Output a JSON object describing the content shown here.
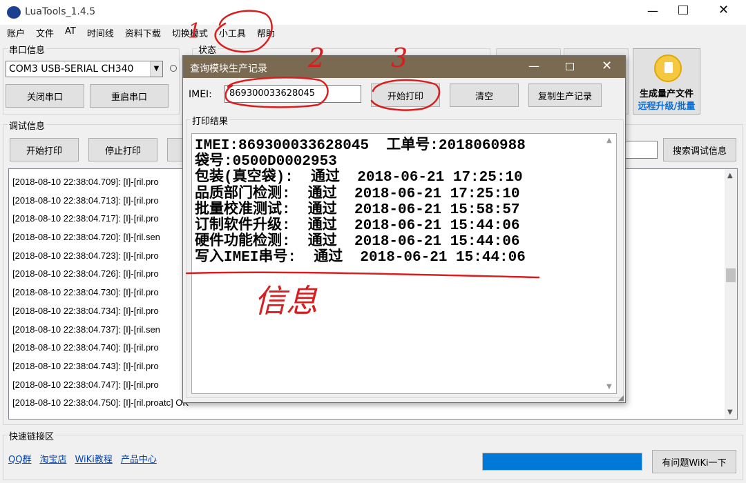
{
  "app": {
    "title": "LuaTools_1.4.5"
  },
  "menu": [
    "账户",
    "文件",
    "AT",
    "时间线",
    "资料下载",
    "切换模式",
    "小工具",
    "帮助"
  ],
  "serial": {
    "group_label": "串口信息",
    "port_value": "COM3 USB-SERIAL CH340",
    "close_label": "关闭串口",
    "restart_label": "重启串口"
  },
  "status": {
    "group_label": "状态"
  },
  "produce": {
    "label_line1": "生成量产文件",
    "label_line2": "远程升级/批量"
  },
  "debug": {
    "group_label": "调试信息",
    "start_label": "开始打印",
    "stop_label": "停止打印",
    "search_label": "搜索调试信息",
    "log_lines": [
      "[2018-08-10 22:38:04.709]: [I]-[ril.pro",
      "[2018-08-10 22:38:04.713]: [I]-[ril.pro",
      "[2018-08-10 22:38:04.717]: [I]-[ril.pro",
      "[2018-08-10 22:38:04.720]: [I]-[ril.sen",
      "[2018-08-10 22:38:04.723]: [I]-[ril.pro",
      "[2018-08-10 22:38:04.726]: [I]-[ril.pro",
      "[2018-08-10 22:38:04.730]: [I]-[ril.pro",
      "[2018-08-10 22:38:04.734]: [I]-[ril.pro",
      "[2018-08-10 22:38:04.737]: [I]-[ril.sen",
      "[2018-08-10 22:38:04.740]: [I]-[ril.pro",
      "[2018-08-10 22:38:04.743]: [I]-[ril.pro",
      "[2018-08-10 22:38:04.747]: [I]-[ril.pro",
      "[2018-08-10 22:38:04.750]: [I]-[ril.proatc] OK"
    ]
  },
  "quicklinks": {
    "group_label": "快速链接区",
    "links": [
      "QQ群",
      "淘宝店",
      "WiKi教程",
      "产品中心"
    ],
    "progress": 1.0,
    "wiki_button": "有问题WiKi一下"
  },
  "dialog": {
    "title": "查询模块生产记录",
    "imei_label": "IMEI:",
    "imei_value": "869300033628045",
    "start_label": "开始打印",
    "clear_label": "清空",
    "copy_label": "复制生产记录",
    "result_label": "打印结果",
    "result_lines": [
      "IMEI:869300033628045  工单号:2018060988",
      "袋号:0500D0002953",
      "包装(真空袋):  通过  2018-06-21 17:25:10",
      "品质部门检测:  通过  2018-06-21 17:25:10",
      "批量校准测试:  通过  2018-06-21 15:58:57",
      "订制软件升级:  通过  2018-06-21 15:44:06",
      "硬件功能检测:  通过  2018-06-21 15:44:06",
      "写入IMEI串号:  通过  2018-06-21 15:44:06"
    ]
  },
  "annotations": {
    "n1": "1",
    "n2": "2",
    "n3": "3",
    "note": "信息"
  },
  "colors": {
    "accent": "#0078d7",
    "annotation": "#d81e1e",
    "dialog_title_bg": "#7a6a52"
  }
}
